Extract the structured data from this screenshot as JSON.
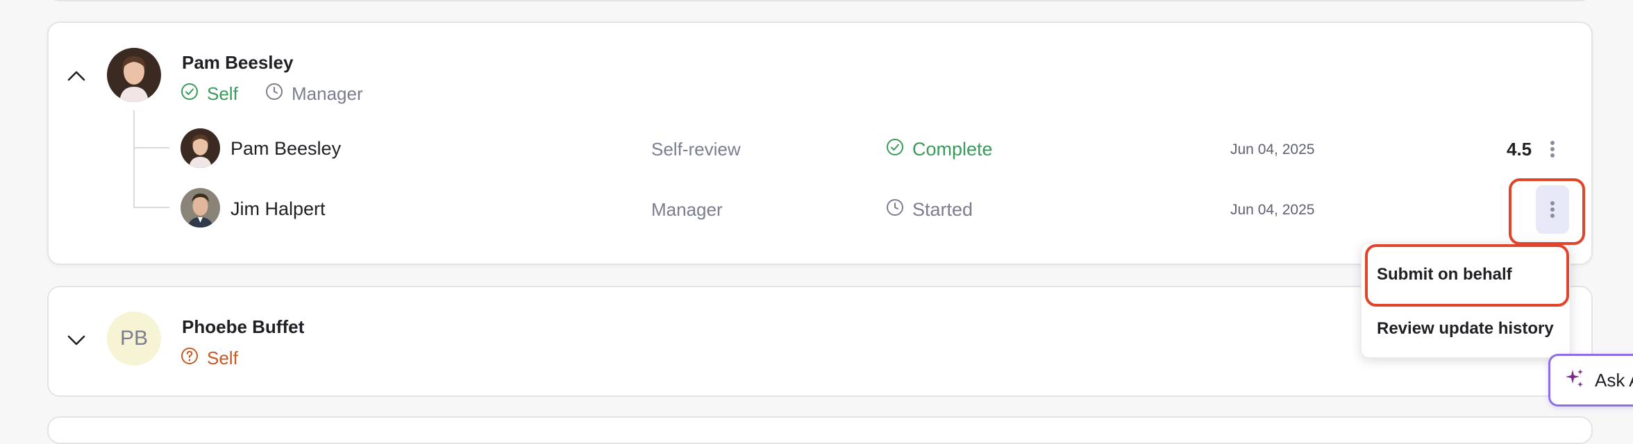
{
  "groups": [
    {
      "name": "Pam Beesley",
      "initials": "",
      "tags": [
        {
          "label": "Self",
          "status": "complete",
          "icon": "check-circle-icon",
          "color": "#3a9a5b"
        },
        {
          "label": "Manager",
          "status": "pending",
          "icon": "clock-icon",
          "color": "#7b7d8f"
        }
      ],
      "reviews": [
        {
          "reviewer": "Pam Beesley",
          "type": "Self-review",
          "status": "Complete",
          "status_icon": "check-circle-icon",
          "date": "Jun 04, 2025",
          "score": "4.5"
        },
        {
          "reviewer": "Jim Halpert",
          "type": "Manager",
          "status": "Started",
          "status_icon": "clock-icon",
          "date": "Jun 04, 2025",
          "score": ""
        }
      ]
    },
    {
      "name": "Phoebe Buffet",
      "initials": "PB",
      "tags": [
        {
          "label": "Self",
          "status": "unknown",
          "icon": "question-circle-icon",
          "color": "#c75a24"
        }
      ]
    }
  ],
  "menu": {
    "items": [
      {
        "label": "Submit on behalf"
      },
      {
        "label": "Review update history"
      }
    ]
  },
  "ask_button": {
    "label": "Ask A",
    "icon": "sparkle-icon"
  },
  "colors": {
    "highlight": "#e0442b",
    "accent_purple": "#8c6ee6",
    "green": "#3a9a5b",
    "orange": "#c75a24"
  }
}
